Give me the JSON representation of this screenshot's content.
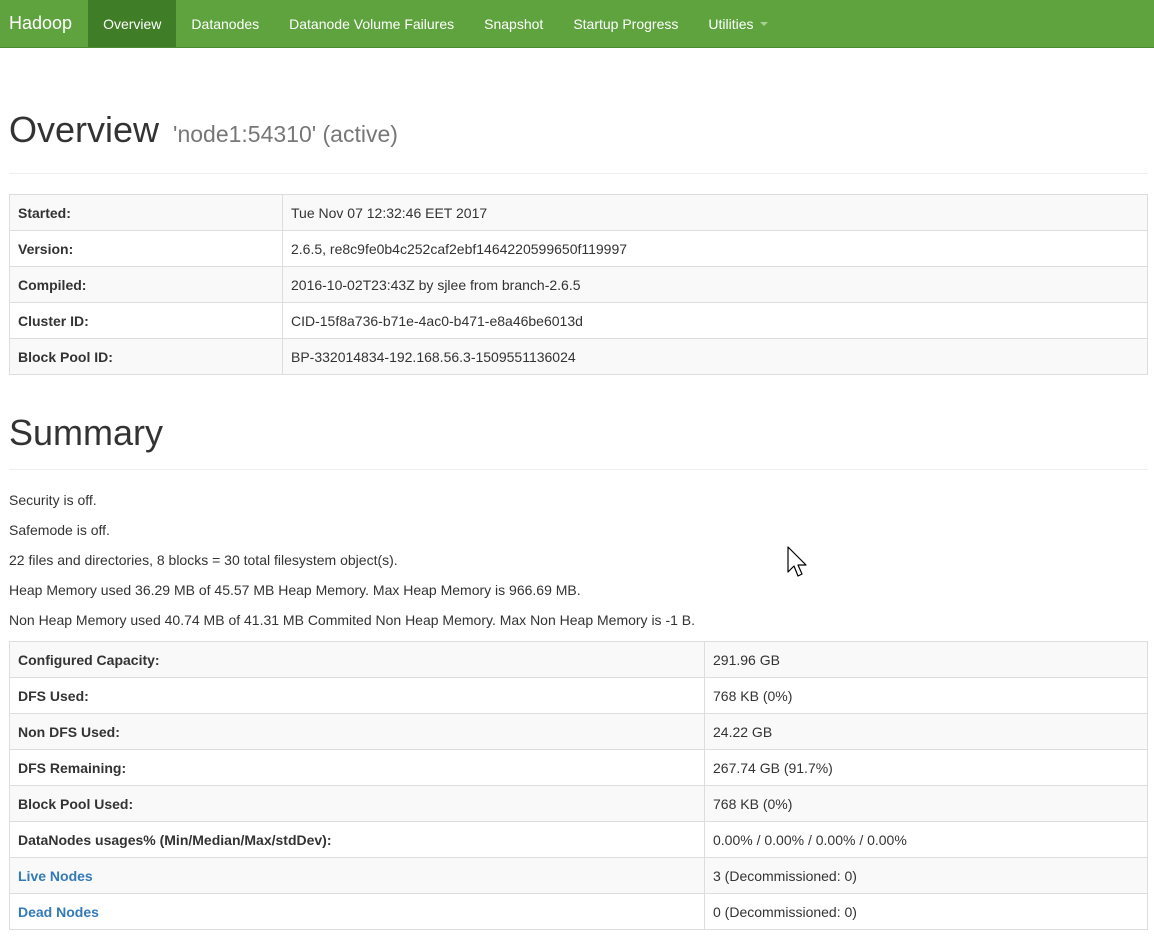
{
  "navbar": {
    "brand": "Hadoop",
    "items": [
      {
        "label": "Overview",
        "active": true
      },
      {
        "label": "Datanodes"
      },
      {
        "label": "Datanode Volume Failures"
      },
      {
        "label": "Snapshot"
      },
      {
        "label": "Startup Progress"
      },
      {
        "label": "Utilities"
      }
    ],
    "color": "#5fa33e",
    "active_color": "#3f7d27"
  },
  "overview": {
    "title": "Overview",
    "subtitle": "'node1:54310' (active)",
    "rows": [
      {
        "label": "Started:",
        "value": "Tue Nov 07 12:32:46 EET 2017"
      },
      {
        "label": "Version:",
        "value": "2.6.5, re8c9fe0b4c252caf2ebf1464220599650f119997"
      },
      {
        "label": "Compiled:",
        "value": "2016-10-02T23:43Z by sjlee from branch-2.6.5"
      },
      {
        "label": "Cluster ID:",
        "value": "CID-15f8a736-b71e-4ac0-b471-e8a46be6013d"
      },
      {
        "label": "Block Pool ID:",
        "value": "BP-332014834-192.168.56.3-1509551136024"
      }
    ]
  },
  "summary": {
    "title": "Summary",
    "lines": [
      "Security is off.",
      "Safemode is off.",
      "22 files and directories, 8 blocks = 30 total filesystem object(s).",
      "Heap Memory used 36.29 MB of 45.57 MB Heap Memory. Max Heap Memory is 966.69 MB.",
      "Non Heap Memory used 40.74 MB of 41.31 MB Commited Non Heap Memory. Max Non Heap Memory is -1 B."
    ],
    "rows": [
      {
        "label": "Configured Capacity:",
        "value": "291.96 GB"
      },
      {
        "label": "DFS Used:",
        "value": "768 KB (0%)"
      },
      {
        "label": "Non DFS Used:",
        "value": "24.22 GB"
      },
      {
        "label": "DFS Remaining:",
        "value": "267.74 GB (91.7%)"
      },
      {
        "label": "Block Pool Used:",
        "value": "768 KB (0%)"
      },
      {
        "label": "DataNodes usages% (Min/Median/Max/stdDev):",
        "value": "0.00% / 0.00% / 0.00% / 0.00%"
      },
      {
        "label": "Live Nodes",
        "value": "3 (Decommissioned: 0)"
      },
      {
        "label": "Dead Nodes",
        "value": "0 (Decommissioned: 0)"
      }
    ],
    "link_color": "#337ab7"
  }
}
